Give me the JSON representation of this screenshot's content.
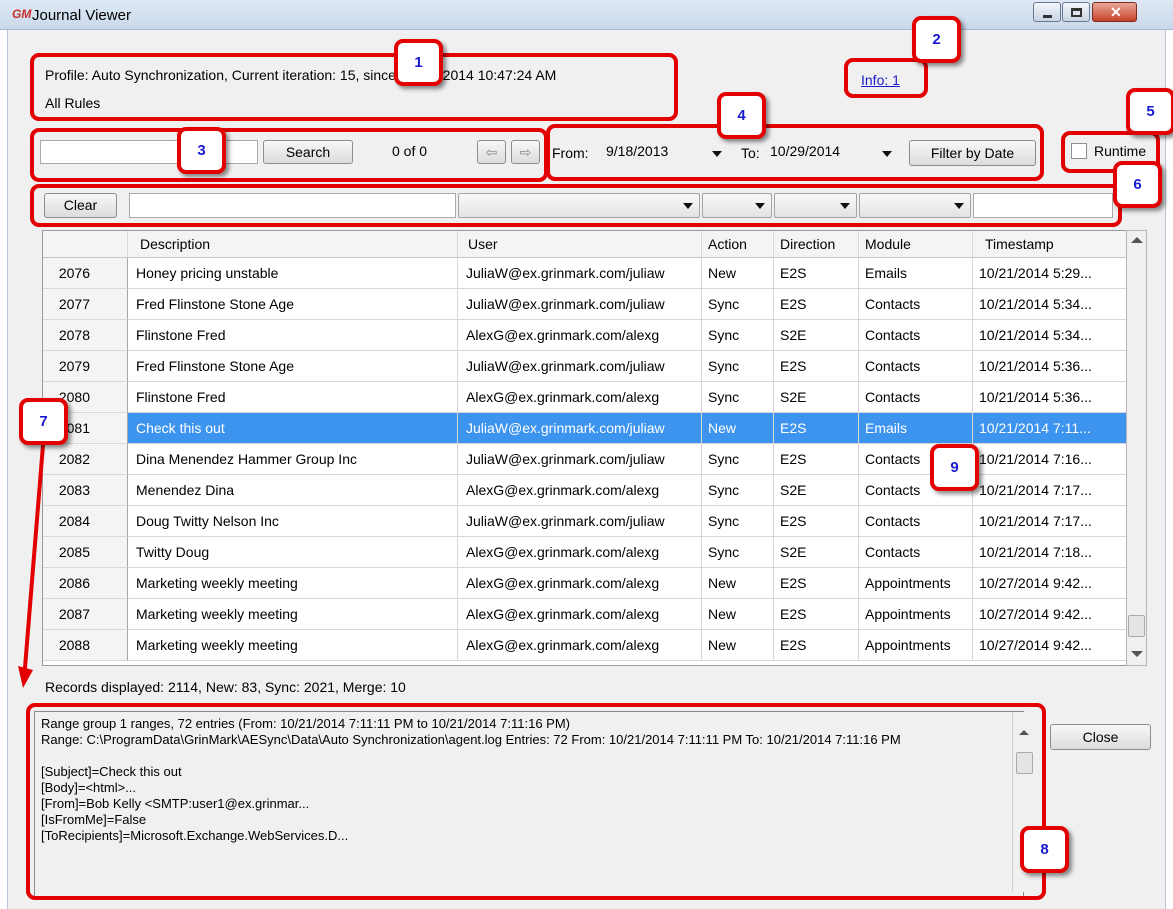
{
  "window": {
    "app_icon": "GM",
    "title": "Journal Viewer"
  },
  "profile": {
    "line1": "Profile: Auto Synchronization, Current iteration: 15, since: 10/29/2014 10:47:24 AM",
    "line2": "All Rules"
  },
  "info_link": "Info: 1",
  "search": {
    "value": "",
    "button": "Search",
    "counter": "0 of 0"
  },
  "date_filter": {
    "from_label": "From:",
    "from_value": "9/18/2013",
    "to_label": "To:",
    "to_value": "10/29/2014",
    "button": "Filter by Date"
  },
  "runtime": {
    "label": "Runtime",
    "checked": false
  },
  "filter_bar": {
    "clear_button": "Clear"
  },
  "grid": {
    "columns": [
      "",
      "Description",
      "User",
      "Action",
      "Direction",
      "Module",
      "Timestamp"
    ],
    "rows": [
      [
        "2076",
        "Honey pricing unstable",
        "JuliaW@ex.grinmark.com/juliaw",
        "New",
        "E2S",
        "Emails",
        "10/21/2014 5:29..."
      ],
      [
        "2077",
        "Fred Flinstone Stone Age",
        "JuliaW@ex.grinmark.com/juliaw",
        "Sync",
        "E2S",
        "Contacts",
        "10/21/2014 5:34..."
      ],
      [
        "2078",
        "Flinstone Fred",
        "AlexG@ex.grinmark.com/alexg",
        "Sync",
        "S2E",
        "Contacts",
        "10/21/2014 5:34..."
      ],
      [
        "2079",
        "Fred Flinstone Stone Age",
        "JuliaW@ex.grinmark.com/juliaw",
        "Sync",
        "E2S",
        "Contacts",
        "10/21/2014 5:36..."
      ],
      [
        "2080",
        "Flinstone Fred",
        "AlexG@ex.grinmark.com/alexg",
        "Sync",
        "S2E",
        "Contacts",
        "10/21/2014 5:36..."
      ],
      [
        "2081",
        "Check this out",
        "JuliaW@ex.grinmark.com/juliaw",
        "New",
        "E2S",
        "Emails",
        "10/21/2014 7:11..."
      ],
      [
        "2082",
        "Dina Menendez Hammer Group Inc",
        "JuliaW@ex.grinmark.com/juliaw",
        "Sync",
        "E2S",
        "Contacts",
        "10/21/2014 7:16..."
      ],
      [
        "2083",
        "Menendez Dina",
        "AlexG@ex.grinmark.com/alexg",
        "Sync",
        "S2E",
        "Contacts",
        "10/21/2014 7:17..."
      ],
      [
        "2084",
        "Doug Twitty Nelson Inc",
        "JuliaW@ex.grinmark.com/juliaw",
        "Sync",
        "E2S",
        "Contacts",
        "10/21/2014 7:17..."
      ],
      [
        "2085",
        "Twitty Doug",
        "AlexG@ex.grinmark.com/alexg",
        "Sync",
        "S2E",
        "Contacts",
        "10/21/2014 7:18..."
      ],
      [
        "2086",
        "Marketing weekly meeting",
        "AlexG@ex.grinmark.com/alexg",
        "New",
        "E2S",
        "Appointments",
        "10/27/2014 9:42..."
      ],
      [
        "2087",
        "Marketing weekly meeting",
        "AlexG@ex.grinmark.com/alexg",
        "New",
        "E2S",
        "Appointments",
        "10/27/2014 9:42..."
      ],
      [
        "2088",
        "Marketing weekly meeting",
        "AlexG@ex.grinmark.com/alexg",
        "New",
        "E2S",
        "Appointments",
        "10/27/2014 9:42..."
      ]
    ],
    "selected_row": 5,
    "selection_color": "#3d94ee"
  },
  "records_summary": "Records displayed: 2114, New: 83, Sync: 2021, Merge: 10",
  "details": {
    "lines": [
      "Range group 1 ranges, 72 entries (From: 10/21/2014 7:11:11 PM to 10/21/2014 7:11:16 PM)",
      "Range: C:\\ProgramData\\GrinMark\\AESync\\Data\\Auto Synchronization\\agent.log Entries: 72 From: 10/21/2014 7:11:11 PM To: 10/21/2014 7:11:16 PM",
      "",
      "[Subject]=Check this out",
      "[Body]=<html>...",
      "[From]=Bob Kelly <SMTP:user1@ex.grinmar...",
      "[IsFromMe]=False",
      "[ToRecipients]=Microsoft.Exchange.WebServices.D..."
    ]
  },
  "close_button": "Close",
  "callouts": [
    "1",
    "2",
    "3",
    "4",
    "5",
    "6",
    "7",
    "8",
    "9"
  ],
  "colors": {
    "callout_border": "#e30000",
    "callout_number": "#1a1ad0"
  }
}
